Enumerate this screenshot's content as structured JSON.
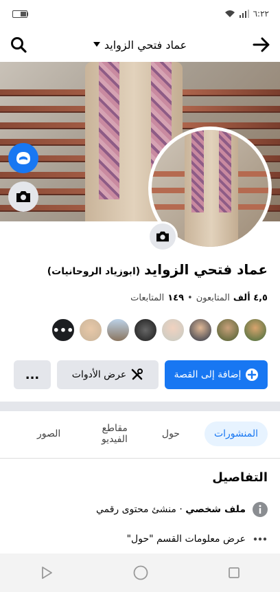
{
  "status": {
    "time": "٦:٢٢"
  },
  "header": {
    "title": "عماد فتحي الزوايد"
  },
  "profile": {
    "name": "عماد فتحي الزوايد",
    "alt_name": "(ابوزياد الروحانيات)",
    "followers_count": "٤,٥ ألف",
    "followers_label": "المتابعون",
    "separator": "•",
    "following_count": "١٤٩",
    "following_label": "المتابعات"
  },
  "actions": {
    "add_story": "إضافة إلى القصة",
    "tools": "عرض الأدوات",
    "more": "..."
  },
  "tabs": [
    "المنشورات",
    "حول",
    "مقاطع الفيديو",
    "الصور"
  ],
  "details": {
    "title": "التفاصيل",
    "row1_bold": "ملف شخصي",
    "row1_rest": " · منشئ محتوى رقمي",
    "row2": "عرض معلومات القسم \"حول\""
  },
  "colors": {
    "accent": "#1877f2",
    "tab_active_bg": "#e7f3ff"
  }
}
